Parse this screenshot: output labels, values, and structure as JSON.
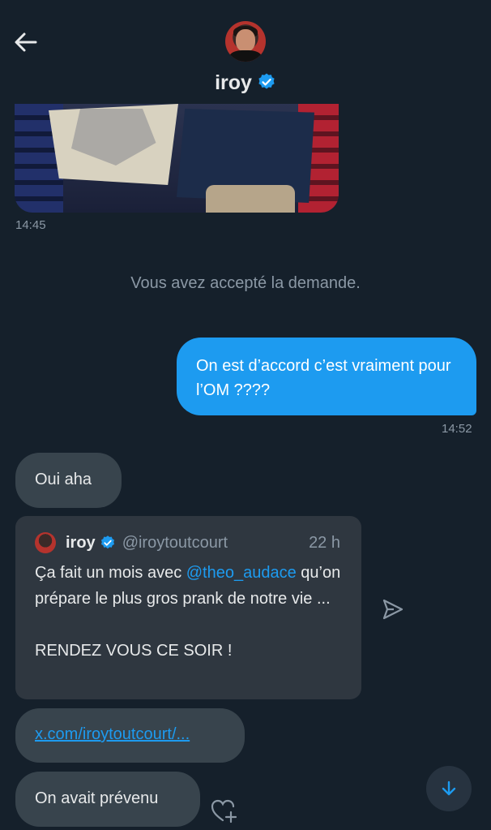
{
  "header": {
    "name": "iroy",
    "back_icon": "arrow-left-icon",
    "verified_icon": "verified-badge-icon"
  },
  "messages": {
    "media_time": "14:45",
    "system_notice": "Vous avez accepté la demande.",
    "outgoing_text": "On est d’accord c’est vraiment pour l’OM ????",
    "outgoing_time": "14:52",
    "incoming_1": "Oui aha",
    "quoted_tweet": {
      "name": "iroy",
      "handle": "@iroytoutcourt",
      "time": "22 h",
      "text_before": "Ça fait un mois avec ",
      "mention": "@theo_audace",
      "text_after": " qu’on prépare le plus gros prank de notre vie ...",
      "text_line2": "RENDEZ VOUS CE SOIR !"
    },
    "link_text": "x.com/iroytoutcourt/...",
    "incoming_2": "On avait prévenu"
  },
  "colors": {
    "background": "#15202b",
    "accent": "#1d9bf0",
    "incoming_bubble": "#38444d",
    "muted_text": "#8b98a5"
  }
}
